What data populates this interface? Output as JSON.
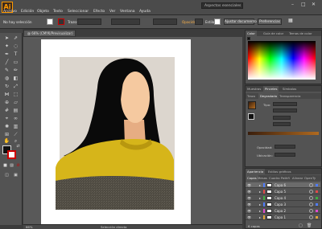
{
  "app": {
    "logo": "Ai",
    "workspace_search_placeholder": "Aspectos esenciales"
  },
  "menu": [
    "Archivo",
    "Edición",
    "Objeto",
    "Texto",
    "Seleccionar",
    "Efecto",
    "Ver",
    "Ventana",
    "Ayuda"
  ],
  "control_bar": {
    "selection_label": "No hay selección",
    "stroke_label": "Trazo:",
    "opacity_label": "Opacidad:",
    "opacity_value": "100%",
    "style_label": "Estilo:",
    "doc_setup_button": "Ajustar documento",
    "prefs_button": "Preferencias"
  },
  "document": {
    "tab_title": "@ 66% (CMYK/Previsualizar)",
    "status_zoom": "66%",
    "status_tool": "Selección directa"
  },
  "color_panel": {
    "tabs": [
      "Color",
      "Guía de color",
      "Temas de color"
    ]
  },
  "swatch_panel": {
    "tabs": [
      "Muestras",
      "Pinceles",
      "Símbolos"
    ]
  },
  "gradient_panel": {
    "tabs": [
      "Trazo",
      "Degradado",
      "Transparencia"
    ],
    "type_label": "Tipo:",
    "opacity_label": "Opacidad:",
    "location_label": "Ubicación:"
  },
  "appearance_panel": {
    "tabs": [
      "Apariencia",
      "Estilos gráficos"
    ]
  },
  "layers_panel": {
    "tabs": [
      "Capas",
      "Mesas",
      "Cuadro",
      "Pathfi",
      "Alinear",
      "OpenTy"
    ],
    "layers": [
      {
        "name": "Capa 6",
        "color": "#4f7cff",
        "selected": true
      },
      {
        "name": "Capa 5",
        "color": "#e04a4a",
        "selected": false
      },
      {
        "name": "Capa 4",
        "color": "#3fae3f",
        "selected": false
      },
      {
        "name": "Capa 3",
        "color": "#4f7cff",
        "selected": false
      },
      {
        "name": "Capa 2",
        "color": "#e04ad0",
        "selected": false
      },
      {
        "name": "Capa 1",
        "color": "#e0a43a",
        "selected": false
      }
    ],
    "footer": "6 capas"
  },
  "colors": {
    "accent": "#ff9a00",
    "skin": "#f5c9a0",
    "hair": "#0a0a0a",
    "sweater": "#d6b51a",
    "skirt": "#545047",
    "background": "#dcd6ce"
  }
}
